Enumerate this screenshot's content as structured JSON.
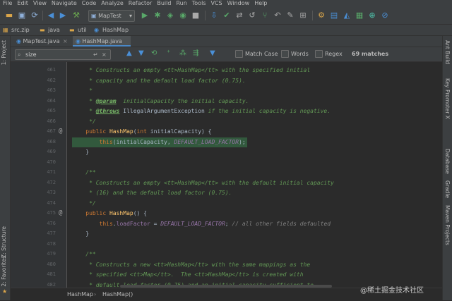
{
  "menu": [
    "File",
    "Edit",
    "View",
    "Navigate",
    "Code",
    "Analyze",
    "Refactor",
    "Build",
    "Run",
    "Tools",
    "VCS",
    "Window",
    "Help"
  ],
  "toolbar": {
    "run_config": "MapTest"
  },
  "nav": {
    "items": [
      "src.zip",
      "java",
      "util",
      "HashMap"
    ]
  },
  "left_tools": {
    "project": "1: Project",
    "structure": "Z: Structure",
    "favorites": "2: Favorites"
  },
  "right_tools": {
    "ant_build": "Ant Build",
    "key_promoter": "Key Promoter X",
    "database": "Database",
    "gradle": "Gradle",
    "maven": "Maven Projects"
  },
  "tabs": [
    {
      "label": "MapTest.java"
    },
    {
      "label": "HashMap.java"
    }
  ],
  "find": {
    "query": "size",
    "match_case": "Match Case",
    "words": "Words",
    "regex": "Regex",
    "count": "69 matches"
  },
  "editor": {
    "line_numbers": [
      "461",
      "462",
      "463",
      "464",
      "465",
      "466",
      "467",
      "468",
      "469",
      "470",
      "471",
      "472",
      "473",
      "474",
      "475",
      "476",
      "477",
      "478",
      "479",
      "480",
      "481",
      "482"
    ],
    "lines": [
      [
        {
          "t": "     * Constructs an empty <tt>HashMap</tt> with the specified initial",
          "c": "cm"
        }
      ],
      [
        {
          "t": "     * capacity and the default load factor (0.75).",
          "c": "cm"
        }
      ],
      [
        {
          "t": "     *",
          "c": "cm"
        }
      ],
      [
        {
          "t": "     * ",
          "c": "cm"
        },
        {
          "t": "@param",
          "c": "tag"
        },
        {
          "t": "  initialCapacity the initial capacity.",
          "c": "cm"
        }
      ],
      [
        {
          "t": "     * ",
          "c": "cm"
        },
        {
          "t": "@throws",
          "c": "tag"
        },
        {
          "t": " IllegalArgumentException",
          "c": "plain"
        },
        {
          "t": " if the initial capacity is negative.",
          "c": "cm"
        }
      ],
      [
        {
          "t": "     */",
          "c": "cm"
        }
      ],
      [
        {
          "t": "    ",
          "c": "plain"
        },
        {
          "t": "public ",
          "c": "kw"
        },
        {
          "t": "HashMap",
          "c": "fn"
        },
        {
          "t": "(",
          "c": "plain"
        },
        {
          "t": "int ",
          "c": "kw"
        },
        {
          "t": "initialCapacity) {",
          "c": "plain"
        }
      ],
      [
        {
          "t": "        ",
          "c": "plain"
        },
        {
          "t": "this",
          "c": "kw"
        },
        {
          "t": "(initialCapacity, ",
          "c": "plain"
        },
        {
          "t": "DEFAULT_LOAD_FACTOR",
          "c": "cst"
        },
        {
          "t": ");",
          "c": "plain"
        }
      ],
      [
        {
          "t": "    }",
          "c": "plain"
        }
      ],
      [
        {
          "t": "",
          "c": "plain"
        }
      ],
      [
        {
          "t": "    /**",
          "c": "cm"
        }
      ],
      [
        {
          "t": "     * Constructs an empty <tt>HashMap</tt> with the default initial capacity",
          "c": "cm"
        }
      ],
      [
        {
          "t": "     * (16) and the default load factor (0.75).",
          "c": "cm"
        }
      ],
      [
        {
          "t": "     */",
          "c": "cm"
        }
      ],
      [
        {
          "t": "    ",
          "c": "plain"
        },
        {
          "t": "public ",
          "c": "kw"
        },
        {
          "t": "HashMap",
          "c": "fn"
        },
        {
          "t": "() {",
          "c": "plain"
        }
      ],
      [
        {
          "t": "        ",
          "c": "plain"
        },
        {
          "t": "this",
          "c": "kw"
        },
        {
          "t": ".",
          "c": "plain"
        },
        {
          "t": "loadFactor",
          "c": "fld"
        },
        {
          "t": " = ",
          "c": "plain"
        },
        {
          "t": "DEFAULT_LOAD_FACTOR",
          "c": "cst"
        },
        {
          "t": "; ",
          "c": "plain"
        },
        {
          "t": "// all other fields defaulted",
          "c": "cmg"
        }
      ],
      [
        {
          "t": "    }",
          "c": "plain"
        }
      ],
      [
        {
          "t": "",
          "c": "plain"
        }
      ],
      [
        {
          "t": "    /**",
          "c": "cm"
        }
      ],
      [
        {
          "t": "     * Constructs a new <tt>HashMap</tt> with the same mappings as the",
          "c": "cm"
        }
      ],
      [
        {
          "t": "     * specified <tt>Map</tt>.  The <tt>HashMap</tt> is created with",
          "c": "cm"
        }
      ],
      [
        {
          "t": "     * default load factor (0.75) and an initial capacity sufficient to",
          "c": "cm"
        }
      ]
    ]
  },
  "bottom_breadcrumb": [
    "HashMap",
    "HashMap()"
  ],
  "watermark": "@稀土掘金技术社区"
}
